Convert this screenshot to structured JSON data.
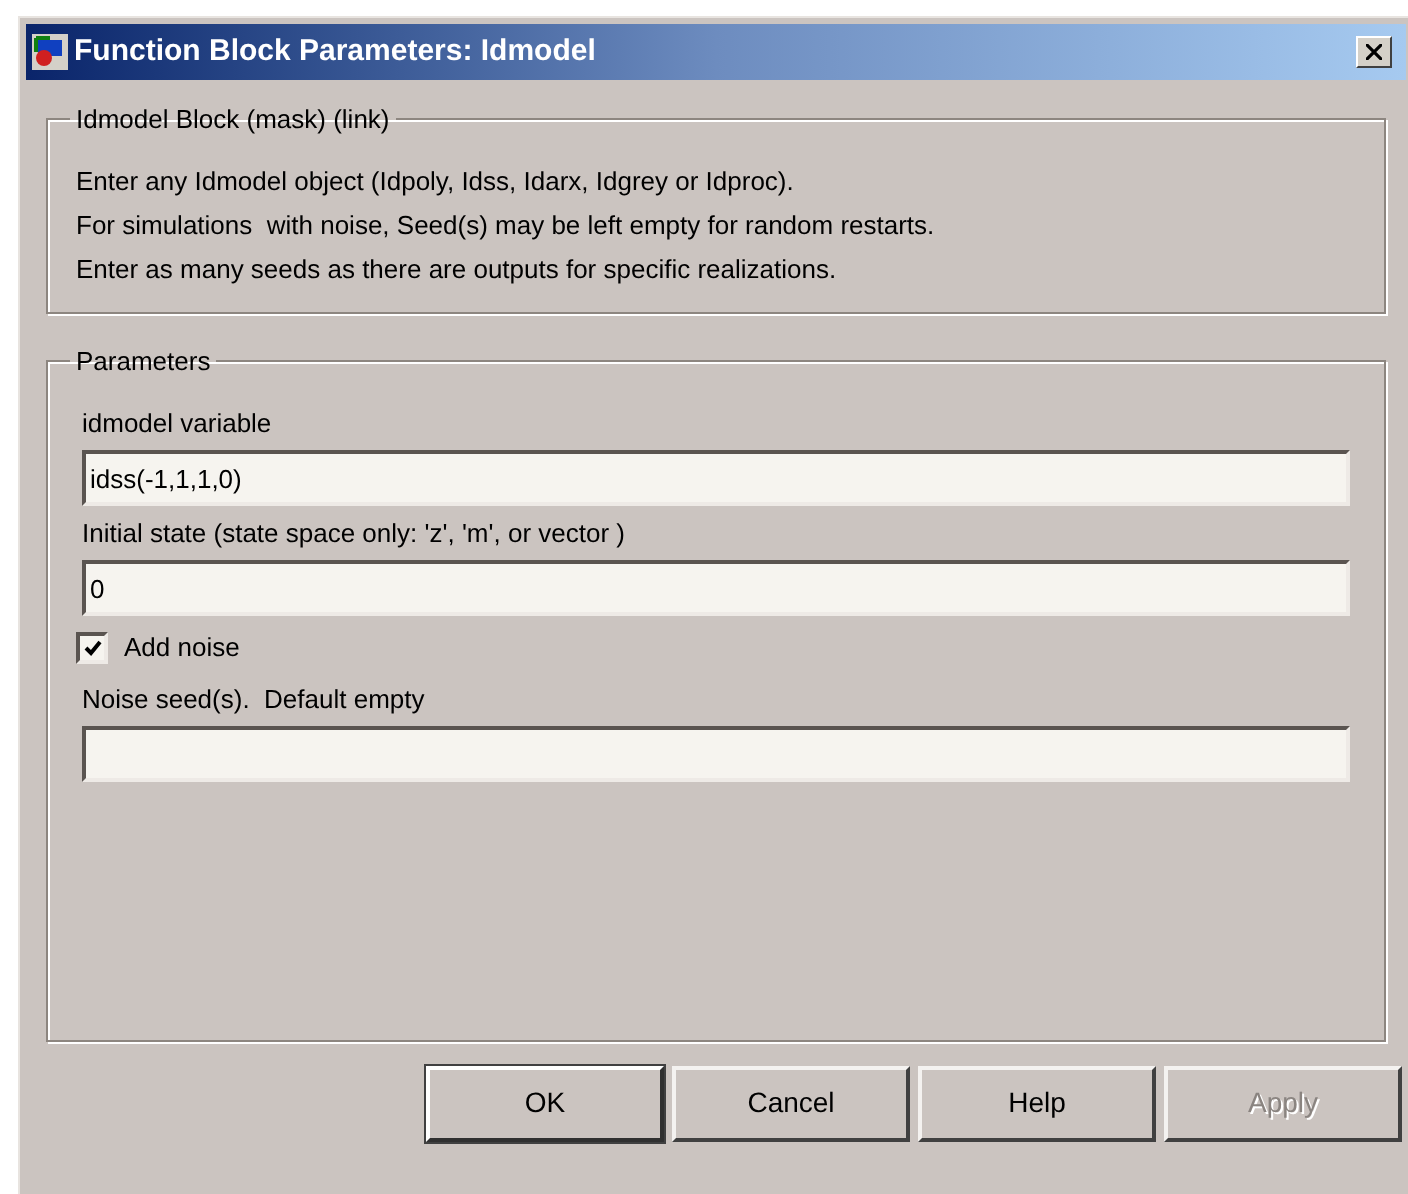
{
  "window": {
    "title": "Function Block Parameters: Idmodel"
  },
  "description_group": {
    "title": "Idmodel Block (mask) (link)",
    "lines": [
      "Enter any Idmodel object (Idpoly, Idss, Idarx, Idgrey or Idproc).",
      "For simulations  with noise, Seed(s) may be left empty for random restarts.",
      "Enter as many seeds as there are outputs for specific realizations."
    ]
  },
  "parameters_group": {
    "title": "Parameters",
    "items": [
      {
        "kind": "field",
        "label": "idmodel variable",
        "value": "idss(-1,1,1,0)"
      },
      {
        "kind": "field",
        "label": "Initial state (state space only: 'z', 'm', or vector )",
        "value": "0"
      },
      {
        "kind": "checkbox",
        "label": "Add noise",
        "checked": true
      },
      {
        "kind": "field",
        "label": "Noise seed(s).  Default empty",
        "value": ""
      }
    ]
  },
  "buttons": [
    {
      "label": "OK",
      "disabled": false,
      "default": true
    },
    {
      "label": "Cancel",
      "disabled": false,
      "default": false
    },
    {
      "label": "Help",
      "disabled": false,
      "default": false
    },
    {
      "label": "Apply",
      "disabled": true,
      "default": false
    }
  ]
}
